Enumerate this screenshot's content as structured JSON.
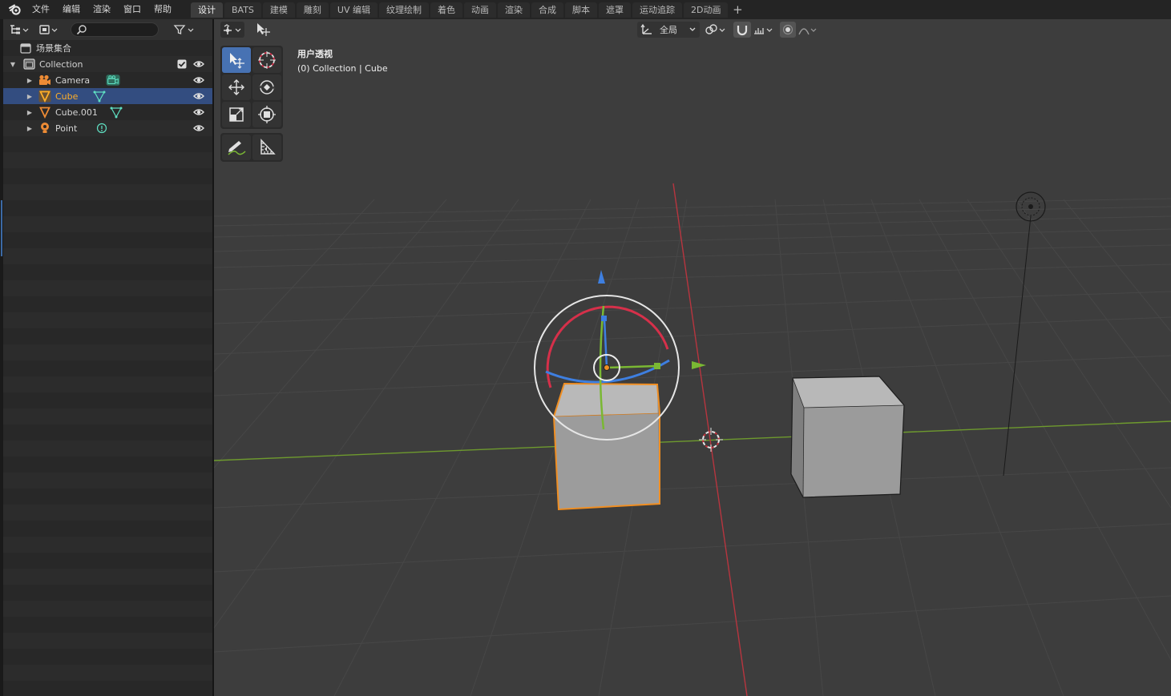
{
  "menus": [
    "文件",
    "编辑",
    "渲染",
    "窗口",
    "帮助"
  ],
  "workspace_tabs": [
    {
      "label": "设计",
      "active": true
    },
    {
      "label": "BATS",
      "active": false
    },
    {
      "label": "建模",
      "active": false
    },
    {
      "label": "雕刻",
      "active": false
    },
    {
      "label": "UV 编辑",
      "active": false
    },
    {
      "label": "纹理绘制",
      "active": false
    },
    {
      "label": "着色",
      "active": false
    },
    {
      "label": "动画",
      "active": false
    },
    {
      "label": "渲染",
      "active": false
    },
    {
      "label": "合成",
      "active": false
    },
    {
      "label": "脚本",
      "active": false
    },
    {
      "label": "遮罩",
      "active": false
    },
    {
      "label": "运动追踪",
      "active": false
    },
    {
      "label": "2D动画",
      "active": false
    }
  ],
  "outliner": {
    "search_placeholder": "",
    "scene_collection": "场景集合",
    "collection": "Collection",
    "items": [
      {
        "label": "Camera",
        "type": "camera",
        "selected": false
      },
      {
        "label": "Cube",
        "type": "mesh",
        "selected": true
      },
      {
        "label": "Cube.001",
        "type": "mesh",
        "selected": false
      },
      {
        "label": "Point",
        "type": "light",
        "selected": false
      }
    ]
  },
  "viewport": {
    "view_name": "用户透视",
    "context": "(0) Collection | Cube",
    "orientation": "全局"
  },
  "colors": {
    "accent": "#4772b3",
    "selected_row": "#334d80",
    "selected_text": "#ffaf29",
    "axis_x": "#d6304a",
    "axis_y": "#7ab833",
    "axis_z": "#3e7fe0",
    "outline_active": "#f08e22"
  }
}
